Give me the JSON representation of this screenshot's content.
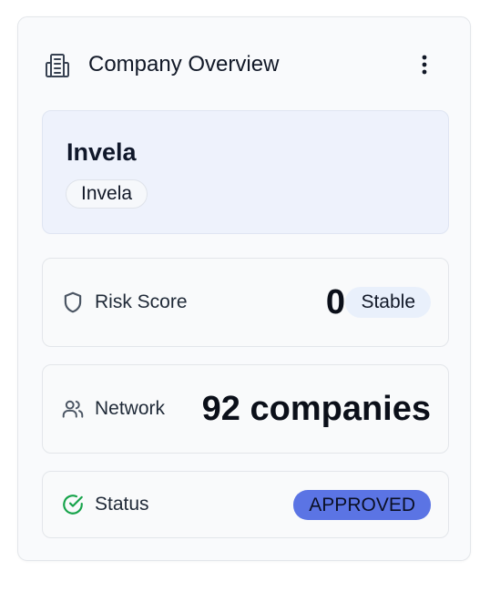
{
  "card": {
    "title": "Company Overview",
    "title_icon": "building-icon",
    "menu_icon": "more-vertical-icon"
  },
  "company": {
    "name": "Invela",
    "tag": "Invela"
  },
  "risk": {
    "icon": "shield-icon",
    "label": "Risk Score",
    "value": "0",
    "badge": "Stable"
  },
  "network": {
    "icon": "users-icon",
    "label": "Network",
    "value": "92 companies"
  },
  "status": {
    "icon": "check-circle-icon",
    "label": "Status",
    "badge": "APPROVED",
    "badge_color": "#5b74e4"
  }
}
